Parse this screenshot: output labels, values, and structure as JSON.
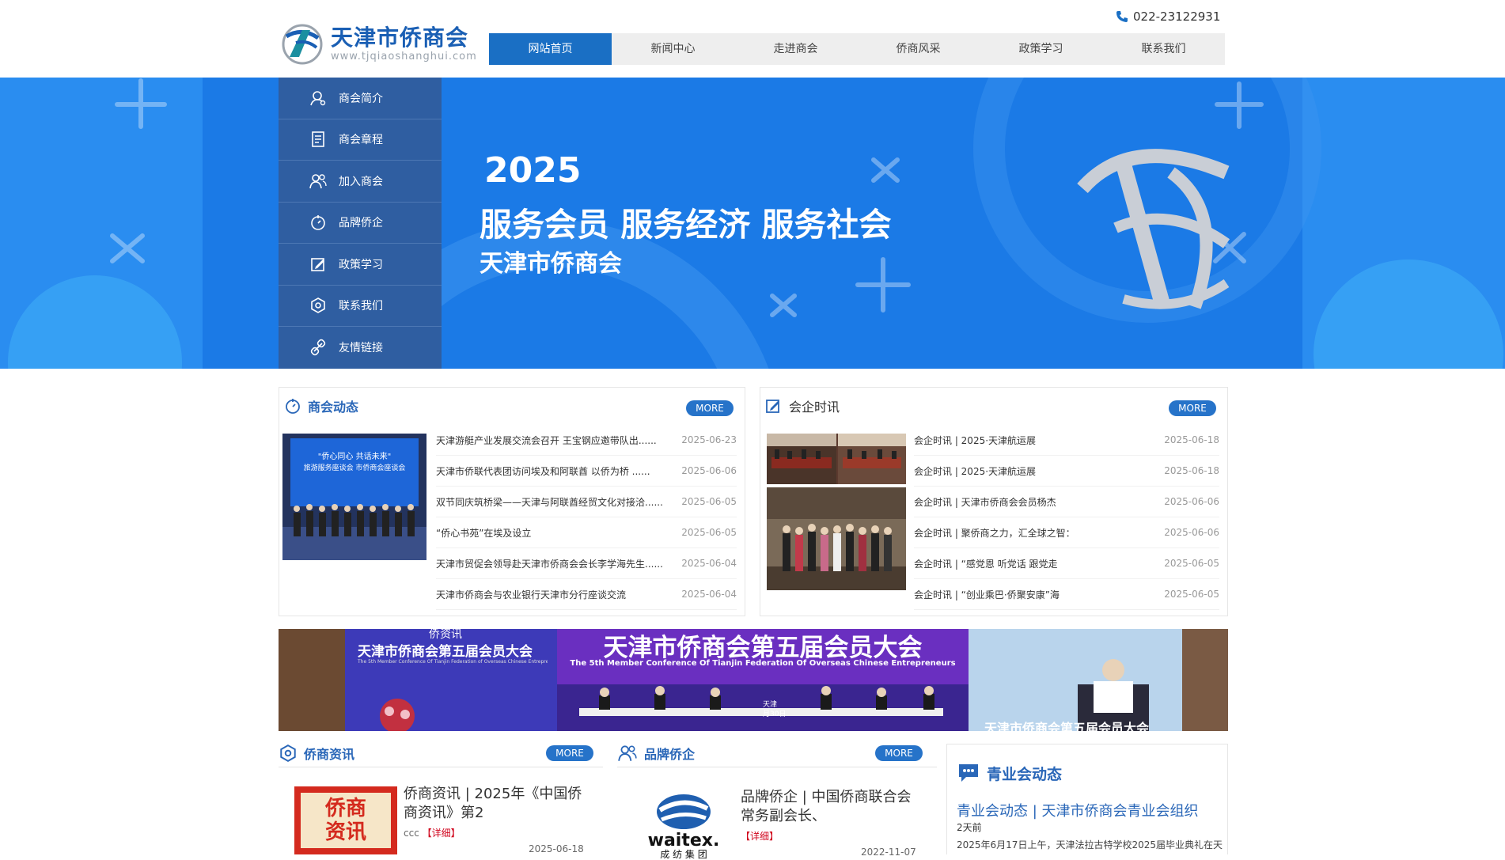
{
  "header": {
    "logo_text": "天津市侨商会",
    "logo_url": "www.tjqiaoshanghui.com",
    "phone": "022-23122931",
    "nav": [
      "网站首页",
      "新闻中心",
      "走进商会",
      "侨商风采",
      "政策学习",
      "联系我们"
    ]
  },
  "side_menu": {
    "items": [
      "商会简介",
      "商会章程",
      "加入商会",
      "品牌侨企",
      "政策学习",
      "联系我们",
      "友情链接"
    ]
  },
  "banner": {
    "year": "2025",
    "slogan": "服务会员 服务经济 服务社会",
    "org": "天津市侨商会"
  },
  "chamber_news": {
    "title": "商会动态",
    "more": "MORE",
    "photo_caption": "\"侨心同心 共话未来\"",
    "photo_caption2": "旅游服务座谈会 市侨商会座谈会",
    "items": [
      {
        "title": "天津游艇产业发展交流会召开 王宝钢应邀带队出......",
        "date": "2025-06-23"
      },
      {
        "title": "天津市侨联代表团访问埃及和阿联酋 以侨为桥 ......",
        "date": "2025-06-06"
      },
      {
        "title": "双节同庆筑桥梁——天津与阿联酋经贸文化对接洽......",
        "date": "2025-06-05"
      },
      {
        "title": "“侨心书苑”在埃及设立",
        "date": "2025-06-05"
      },
      {
        "title": "天津市贸促会领导赴天津市侨商会会长李学海先生......",
        "date": "2025-06-04"
      },
      {
        "title": "天津市侨商会与农业银行天津市分行座谈交流",
        "date": "2025-06-04"
      }
    ]
  },
  "member_news": {
    "title": "会企时讯",
    "more": "MORE",
    "items": [
      {
        "title": "会企时讯 | 2025·天津航运展",
        "date": "2025-06-18"
      },
      {
        "title": "会企时讯 | 2025·天津航运展",
        "date": "2025-06-18"
      },
      {
        "title": "会企时讯 | 天津市侨商会会员杨杰",
        "date": "2025-06-06"
      },
      {
        "title": "会企时讯 | 聚侨商之力，汇全球之智：",
        "date": "2025-06-06"
      },
      {
        "title": "会企时讯 | “感党恩 听党话 跟党走",
        "date": "2025-06-05"
      },
      {
        "title": "会企时讯 | “创业乘巴·侨聚安康”海",
        "date": "2025-06-05"
      }
    ]
  },
  "strip_banner": {
    "title": "天津市侨商会第五届会员大会",
    "subtitle": "The 5th Member Conference Of Tianjin Federation Of Overseas Chinese Entrepreneurs",
    "left_title": "天津市侨商会第五届会员大会",
    "left_sub": "The 5th Member Conference Of Tianjin Federation of Overseas Chinese Entrepreneurs",
    "left_top": "侨资讯",
    "stage_label": "天津",
    "stage_date": "月30日",
    "right_caption": "天津市侨商会第五届会员大会"
  },
  "overseas_info": {
    "title": "侨商资讯",
    "more": "MORE",
    "card_title": "侨商资讯 | 2025年《中国侨商资讯》第2",
    "card_author": "ccc",
    "card_detail": "【详细】",
    "card_date": "2025-06-18",
    "thumb_text_1": "侨商",
    "thumb_text_2": "资讯"
  },
  "brand_enterprise": {
    "title": "品牌侨企",
    "more": "MORE",
    "card_title": "品牌侨企 | 中国侨商联合会常务副会长、",
    "card_detail": "【详细】",
    "card_date": "2022-11-07",
    "logo_text": "waitex.",
    "logo_sub": "成 纺 集 团"
  },
  "youth_news": {
    "title": "青业会动态",
    "headline": "青业会动态 | 天津市侨商会青业会组织",
    "ago": "2天前",
    "excerpt": "2025年6月17日上午，天津法拉古特学校2025届毕业典礼在天"
  },
  "colors": {
    "primary": "#1a6fc4",
    "side_menu": "#2f5ea1",
    "banner": "#1d7fe8",
    "detail_red": "#d0021b"
  }
}
